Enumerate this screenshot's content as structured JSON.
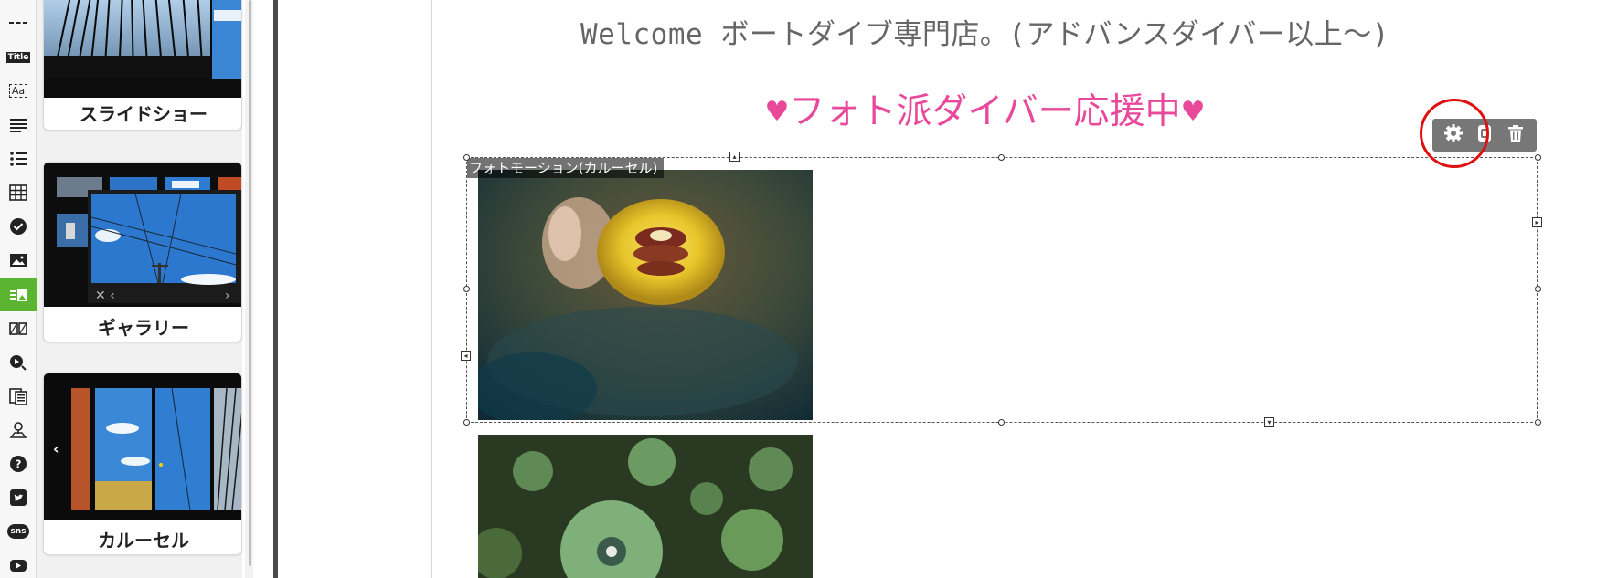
{
  "sidebar": {
    "rail": [
      {
        "name": "divider-tool-icon"
      },
      {
        "name": "title-tool-icon",
        "label": "Title"
      },
      {
        "name": "text-tool-icon",
        "label": "Aa"
      },
      {
        "name": "paragraph-tool-icon"
      },
      {
        "name": "list-tool-icon"
      },
      {
        "name": "table-tool-icon"
      },
      {
        "name": "check-tool-icon"
      },
      {
        "name": "image-tool-icon"
      },
      {
        "name": "photo-motion-tool-icon",
        "active": true
      },
      {
        "name": "columns-tool-icon"
      },
      {
        "name": "media-tool-icon"
      },
      {
        "name": "pages-tool-icon"
      },
      {
        "name": "map-tool-icon"
      },
      {
        "name": "help-tool-icon"
      },
      {
        "name": "twitter-tool-icon"
      },
      {
        "name": "sns-tool-icon",
        "label": "sns"
      },
      {
        "name": "youtube-tool-icon"
      }
    ],
    "widgets": [
      {
        "label": "スライドショー"
      },
      {
        "label": "ギャラリー"
      },
      {
        "label": "カルーセル"
      }
    ]
  },
  "editor": {
    "welcome_text": "Welcome ボートダイブ専門店。(アドバンスダイバー以上〜)",
    "subtitle_text": "フォト派ダイバー応援中",
    "heart_glyph": "♥",
    "block_label": "フォトモーション(カルーセル)",
    "toolbar": {
      "settings_icon": "gear-icon",
      "copy_icon": "copy-icon",
      "delete_icon": "trash-icon"
    }
  },
  "colors": {
    "accent_green": "#5cb531",
    "pink_text": "#e8499b",
    "highlight_red": "#e01010",
    "toolbar_gray": "#777777"
  }
}
